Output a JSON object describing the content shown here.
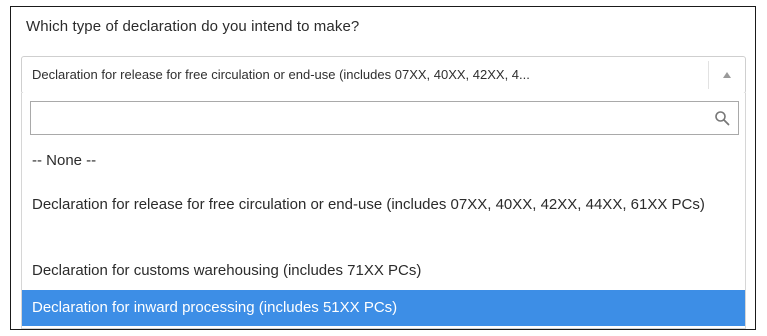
{
  "question": {
    "label": "Which type of declaration do you intend to make?"
  },
  "select": {
    "value": "Declaration for release for free circulation or end-use (includes 07XX, 40XX, 42XX, 4...",
    "arrow_icon": "caret-up-icon"
  },
  "dropdown": {
    "search": {
      "value": "",
      "placeholder": "",
      "icon": "search-icon"
    },
    "options": [
      {
        "label": "-- None --",
        "selected": false
      },
      {
        "label": "Declaration for release for free circulation or end-use (includes 07XX, 40XX, 42XX, 44XX, 61XX PCs)",
        "selected": false
      },
      {
        "label": "Declaration for customs warehousing (includes 71XX PCs)",
        "selected": false
      },
      {
        "label": "Declaration for inward processing (includes 51XX PCs)",
        "selected": true
      }
    ]
  },
  "colors": {
    "selected_background": "#3d8ee6",
    "selected_text": "#ffffff",
    "frame_border": "#1a1a1a"
  }
}
